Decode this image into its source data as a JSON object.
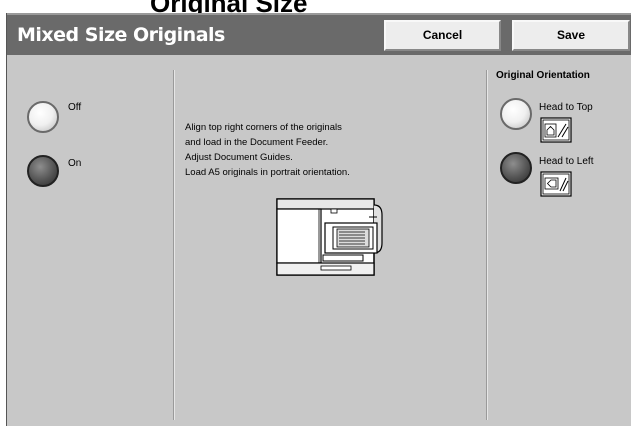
{
  "header": {
    "clipped_heading": "Original Size",
    "title": "Mixed Size Originals",
    "cancel_label": "Cancel",
    "save_label": "Save"
  },
  "mixed_size": {
    "options": [
      {
        "label": "Off",
        "selected": false
      },
      {
        "label": "On",
        "selected": true
      }
    ]
  },
  "instructions": {
    "lines": [
      "Align top right corners of the originals",
      "and load in the Document Feeder.",
      "Adjust Document Guides.",
      "Load A5 originals in portrait orientation."
    ]
  },
  "orientation": {
    "title": "Original Orientation",
    "options": [
      {
        "label": "Head to Top",
        "selected": false,
        "icon": "head-to-top-icon"
      },
      {
        "label": "Head to Left",
        "selected": true,
        "icon": "head-to-left-icon"
      }
    ]
  }
}
